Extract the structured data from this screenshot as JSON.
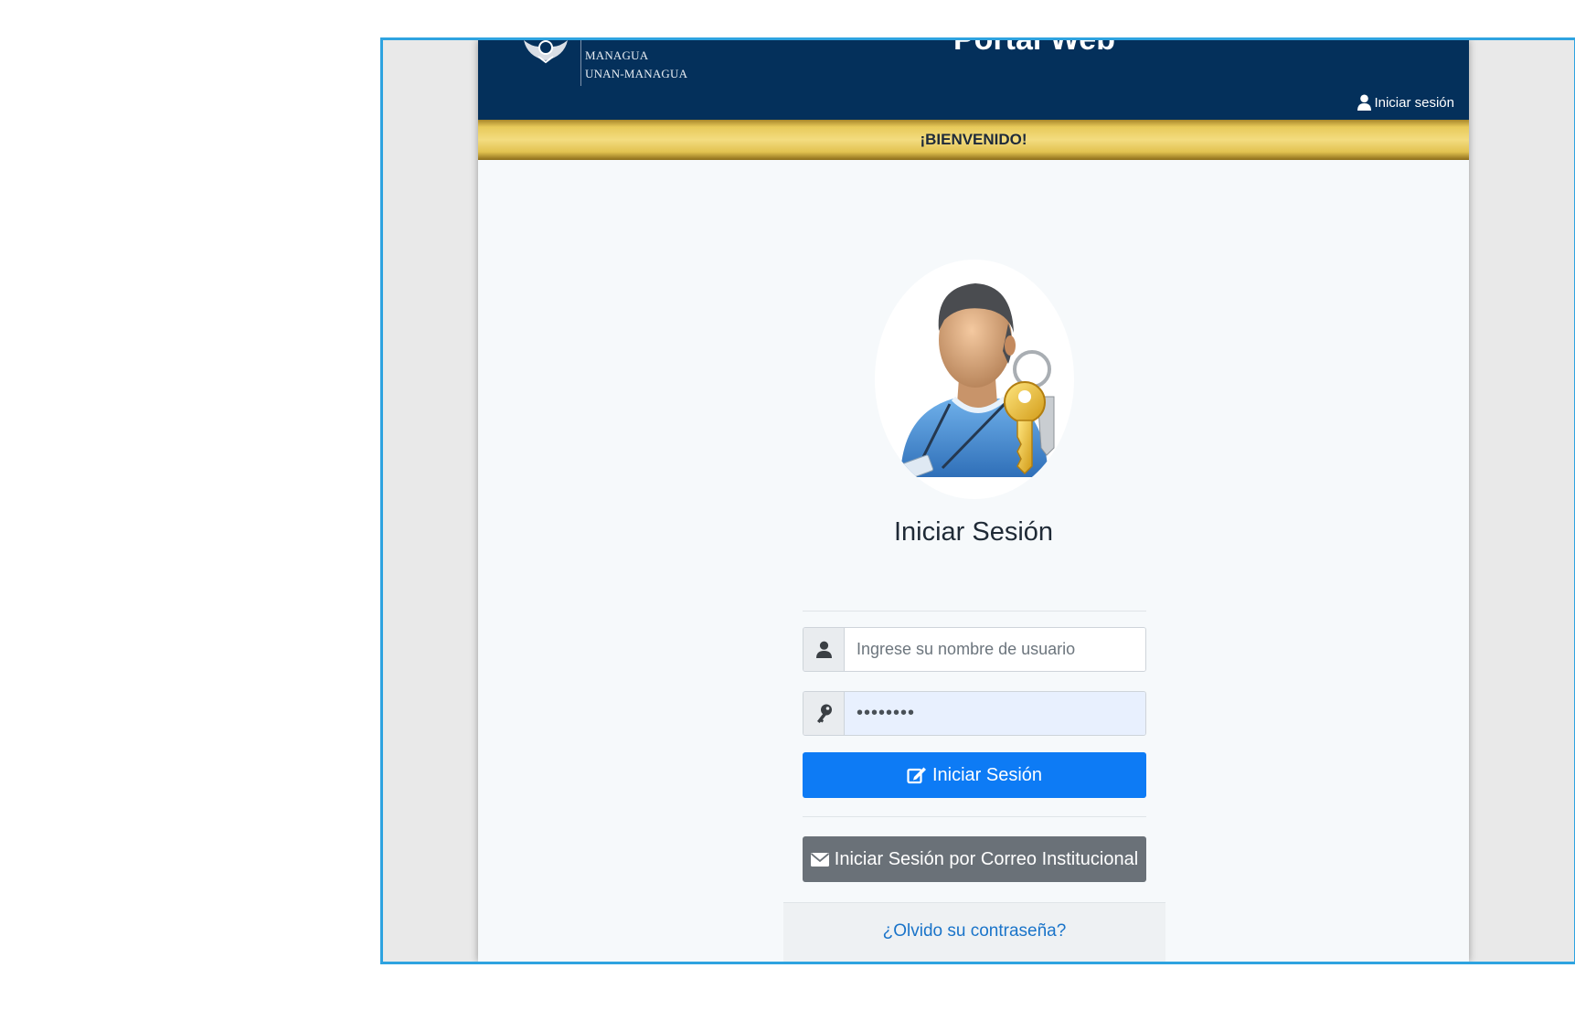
{
  "header": {
    "logo_line1": "MANAGUA",
    "logo_line2": "UNAN-MANAGUA",
    "title": "Portal Web",
    "login_link": "Iniciar sesión"
  },
  "welcome": {
    "text": "¡BIENVENIDO!"
  },
  "login": {
    "title": "Iniciar Sesión",
    "username": {
      "placeholder": "Ingrese su nombre de usuario",
      "value": ""
    },
    "password": {
      "value": "••••••••"
    },
    "submit_label": "Iniciar Sesión",
    "institutional_label": "Iniciar Sesión por Correo Institucional",
    "forgot_label": "¿Olvido su contraseña?"
  },
  "colors": {
    "header_bg": "#04305b",
    "welcome_gold": "#e8ca5a",
    "primary_button": "#0d7bf5",
    "secondary_button": "#6a7178",
    "frame_border": "#2ea3e0",
    "link": "#1a74c9"
  },
  "icons": [
    "seal-logo-icon",
    "user-icon",
    "key-icon",
    "edit-icon",
    "envelope-icon",
    "user-with-key-avatar-icon"
  ]
}
